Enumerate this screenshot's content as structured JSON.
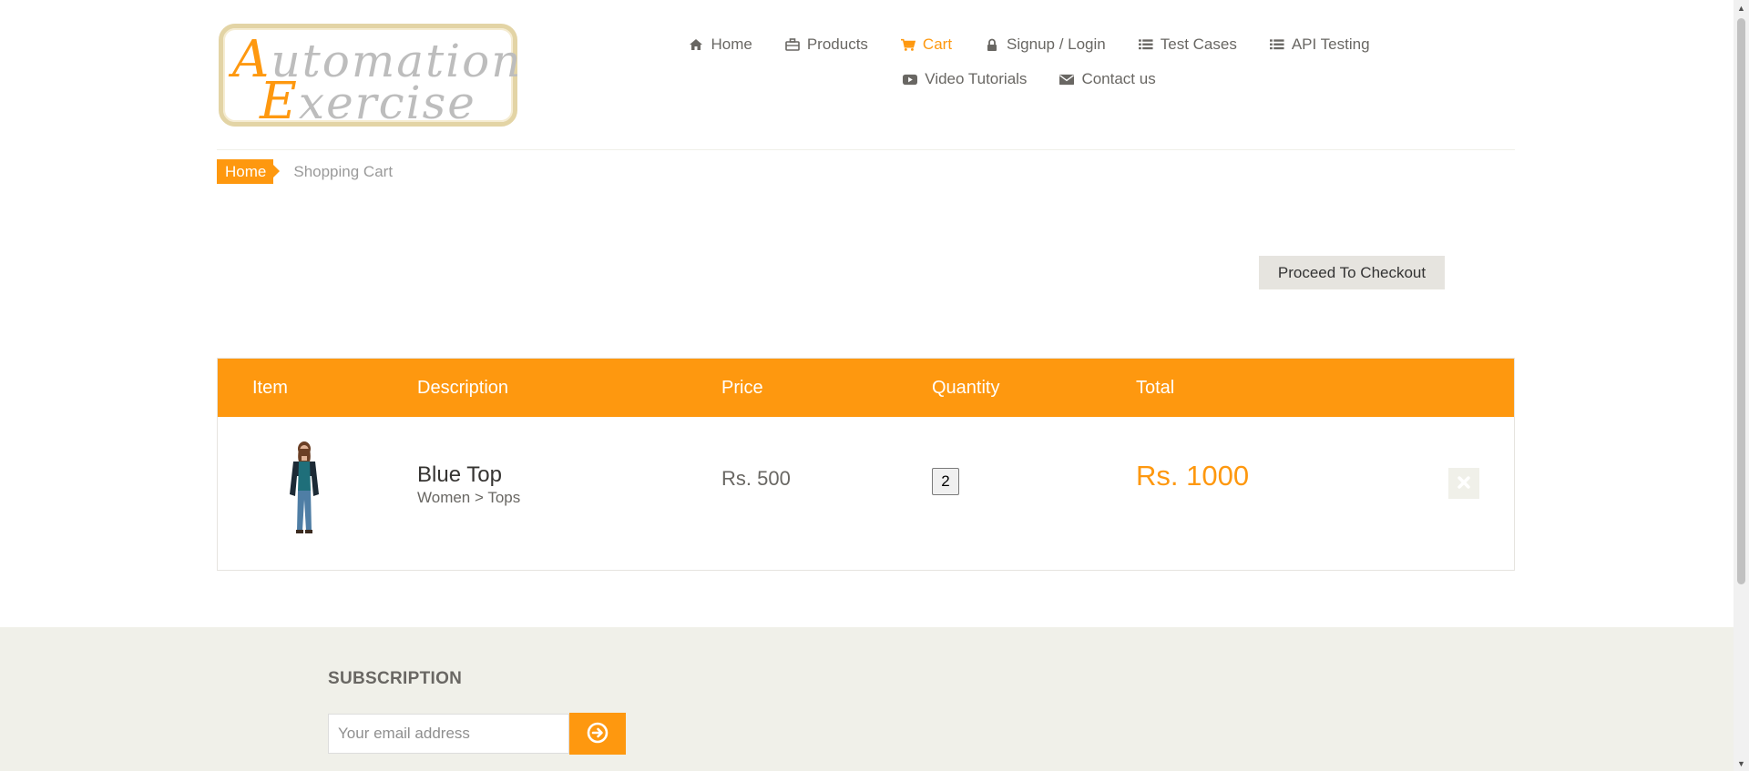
{
  "logo": {
    "line1_cap": "A",
    "line1_rest": "utomation",
    "line2_cap": "E",
    "line2_rest": "xercise"
  },
  "nav": {
    "items": [
      {
        "label": "Home",
        "icon": "home-icon"
      },
      {
        "label": "Products",
        "icon": "briefcase-icon"
      },
      {
        "label": "Cart",
        "icon": "cart-icon",
        "active": true
      },
      {
        "label": "Signup / Login",
        "icon": "lock-icon"
      },
      {
        "label": "Test Cases",
        "icon": "list-icon"
      },
      {
        "label": "API Testing",
        "icon": "list-icon"
      },
      {
        "label": "Video Tutorials",
        "icon": "youtube-icon"
      },
      {
        "label": "Contact us",
        "icon": "envelope-icon"
      }
    ]
  },
  "breadcrumb": {
    "home": "Home",
    "current": "Shopping Cart"
  },
  "checkout": {
    "label": "Proceed To Checkout"
  },
  "table": {
    "headers": [
      "Item",
      "Description",
      "Price",
      "Quantity",
      "Total"
    ],
    "rows": [
      {
        "name": "Blue Top",
        "category": "Women > Tops",
        "price": "Rs. 500",
        "quantity": "2",
        "total": "Rs. 1000",
        "delete_icon": "close-icon"
      }
    ]
  },
  "subscription": {
    "title": "SUBSCRIPTION",
    "placeholder": "Your email address",
    "button_icon": "arrow-circle-right-icon"
  },
  "colors": {
    "accent": "#fe980f",
    "footer_bg": "#f0f0e9",
    "text": "#696763"
  }
}
